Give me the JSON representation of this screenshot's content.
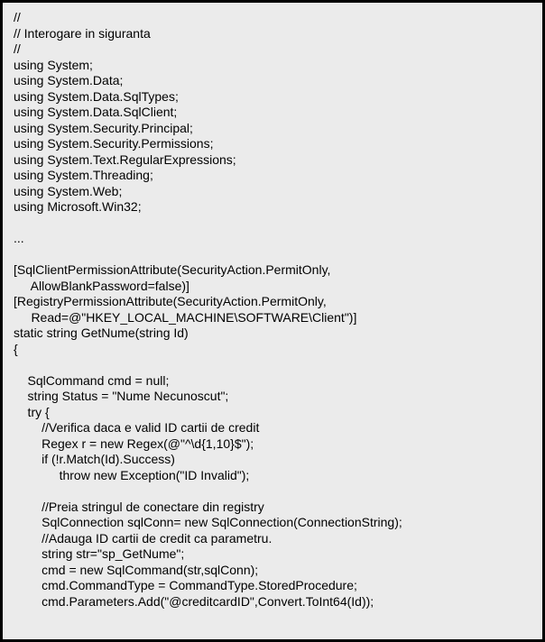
{
  "code": {
    "lines": [
      "//",
      "// Interogare in siguranta",
      "//",
      "using System;",
      "using System.Data;",
      "using System.Data.SqlTypes;",
      "using System.Data.SqlClient;",
      "using System.Security.Principal;",
      "using System.Security.Permissions;",
      "using System.Text.RegularExpressions;",
      "using System.Threading;",
      "using System.Web;",
      "using Microsoft.Win32;",
      "",
      "...",
      "",
      "[SqlClientPermissionAttribute(SecurityAction.PermitOnly,",
      "     AllowBlankPassword=false)]",
      "[RegistryPermissionAttribute(SecurityAction.PermitOnly,",
      "     Read=@\"HKEY_LOCAL_MACHINE\\SOFTWARE\\Client\")]",
      "static string GetNume(string Id)",
      "{",
      "",
      "    SqlCommand cmd = null;",
      "    string Status = \"Nume Necunoscut\";",
      "    try {",
      "        //Verifica daca e valid ID cartii de credit",
      "        Regex r = new Regex(@\"^\\d{1,10}$\");",
      "        if (!r.Match(Id).Success)",
      "             throw new Exception(\"ID Invalid\");",
      "",
      "        //Preia stringul de conectare din registry",
      "        SqlConnection sqlConn= new SqlConnection(ConnectionString);",
      "        //Adauga ID cartii de credit ca parametru.",
      "        string str=\"sp_GetNume\";",
      "        cmd = new SqlCommand(str,sqlConn);",
      "        cmd.CommandType = CommandType.StoredProcedure;",
      "        cmd.Parameters.Add(\"@creditcardID\",Convert.ToInt64(Id));"
    ]
  }
}
